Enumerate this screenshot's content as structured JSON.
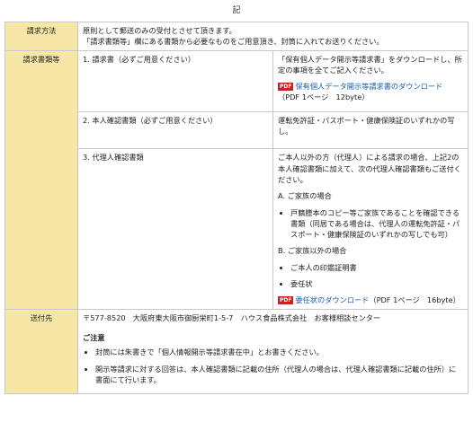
{
  "heading": "記",
  "rows": {
    "method": {
      "label": "請求方法",
      "line1": "原則として郵送のみの受付とさせて頂きます。",
      "line2": "「請求書類等」欄にある書類から必要なものをご用意頂き、封筒に入れてお送りください。"
    },
    "documents": {
      "label": "請求書類等",
      "item1": {
        "title": "1.  請求書（必ずご用意ください）",
        "desc": "「保有個人データ開示等請求書」をダウンロードし、所定の事項を全てご記入ください。",
        "pdf_icon": "PDF",
        "link_text": "保有個人データ開示等請求書のダウンロード",
        "file_info": "（PDF 1ページ　12byte）"
      },
      "item2": {
        "title": "2.  本人確認書類（必ずご用意ください）",
        "desc": "運転免許証・パスポート・健康保険証のいずれかの写し。"
      },
      "item3": {
        "title": "3.  代理人確認書類",
        "intro": "ご本人以外の方（代理人）による請求の場合、上記2の本人確認書類に加えて、次の代理人確認書類もご送付ください。",
        "groupA": "A.  ご家族の場合",
        "a_item1": "戸籍謄本のコピー等ご家族であることを確認できる書類（同居である場合は、代理人の運転免許証・パスポート・健康保険証のいずれかの写しでも可）",
        "groupB": "B.  ご家族以外の場合",
        "b_item1": "ご本人の印鑑証明書",
        "b_item2": "委任状",
        "pdf_icon": "PDF",
        "link_text": "委任状のダウンロード",
        "file_info": "（PDF 1ページ　16byte）"
      }
    },
    "destination": {
      "label": "送付先",
      "address": "〒577-8520　大阪府東大阪市御厨栄町1-5-7　ハウス食品株式会社　お客様相談センター",
      "notice_title": "ご注意",
      "notice1": "封筒には朱書きで「個人情報開示等請求書在中」とお書きください。",
      "notice2": "開示等請求に対する回答は、本人確認書類に記載の住所（代理人の場合は、代理人確認書類に記載の住所）に書面にて行います。"
    }
  }
}
